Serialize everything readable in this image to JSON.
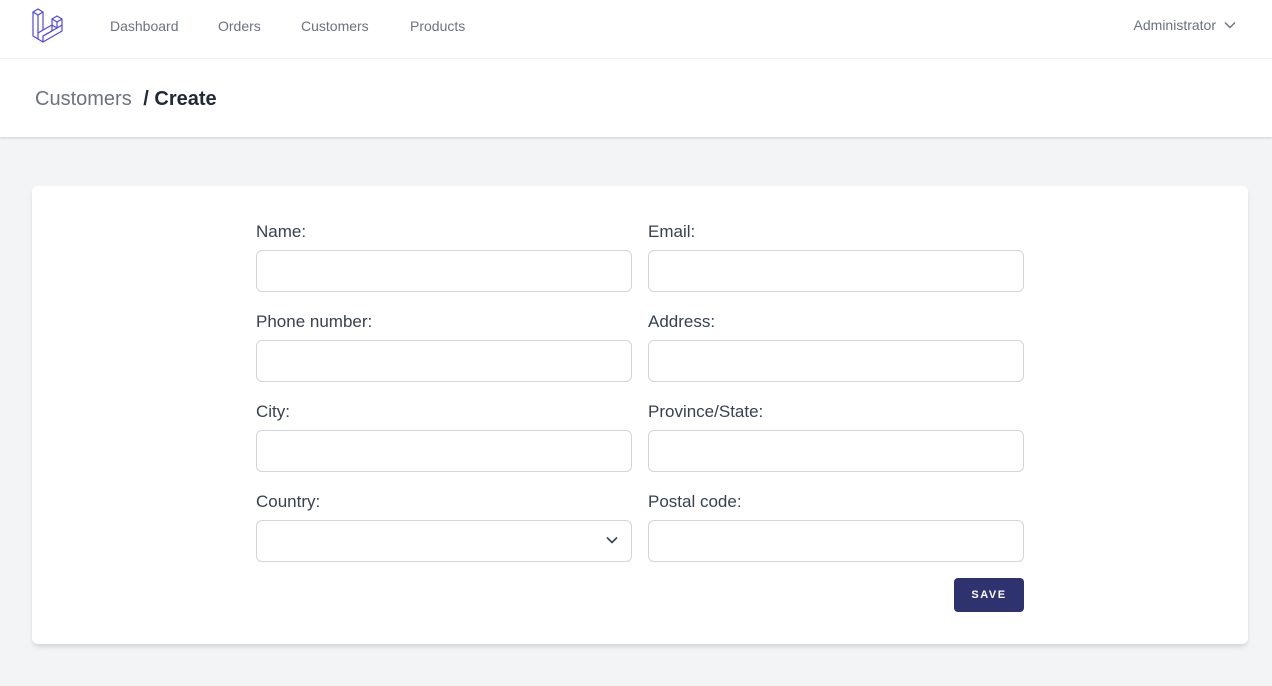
{
  "nav": {
    "links": [
      {
        "label": "Dashboard"
      },
      {
        "label": "Orders"
      },
      {
        "label": "Customers"
      },
      {
        "label": "Products"
      }
    ],
    "user": "Administrator"
  },
  "breadcrumb": {
    "parent": "Customers",
    "separator": "/",
    "current": "Create"
  },
  "form": {
    "name_label": "Name:",
    "name_value": "",
    "email_label": "Email:",
    "email_value": "",
    "phone_label": "Phone number:",
    "phone_value": "",
    "address_label": "Address:",
    "address_value": "",
    "city_label": "City:",
    "city_value": "",
    "province_label": "Province/State:",
    "province_value": "",
    "country_label": "Country:",
    "country_value": "",
    "postal_label": "Postal code:",
    "postal_value": "",
    "save_label": "SAVE"
  },
  "colors": {
    "accent": "#2e3370",
    "logo": "#4f46e5",
    "page_bg": "#f3f4f6"
  },
  "icons": {
    "logo": "laravel-logo-icon",
    "user_menu": "chevron-down-icon",
    "select": "chevron-down-icon"
  }
}
